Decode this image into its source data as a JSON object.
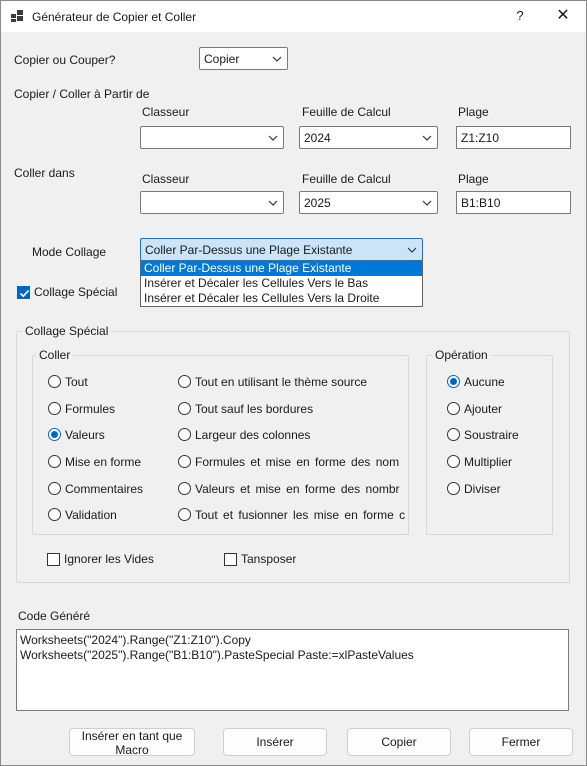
{
  "window": {
    "title": "Générateur de Copier et Coller",
    "help": "?",
    "close": "✕"
  },
  "copy_or_cut": {
    "label": "Copier ou Couper?",
    "value": "Copier"
  },
  "source": {
    "section_label": "Copier / Coller à Partir de",
    "workbook_label": "Classeur",
    "workbook_value": "",
    "sheet_label": "Feuille de Calcul",
    "sheet_value": "2024",
    "range_label": "Plage",
    "range_value": "Z1:Z10"
  },
  "dest": {
    "section_label": "Coller dans",
    "workbook_label": "Classeur",
    "workbook_value": "",
    "sheet_label": "Feuille de Calcul",
    "sheet_value": "2025",
    "range_label": "Plage",
    "range_value": "B1:B10"
  },
  "paste_mode": {
    "label": "Mode Collage",
    "value": "Coller Par-Dessus une Plage Existante",
    "options": [
      "Coller Par-Dessus une Plage Existante",
      "Insérer et Décaler les Cellules Vers le Bas",
      "Insérer et Décaler les Cellules Vers la Droite"
    ]
  },
  "special_checkbox": {
    "label": "Collage Spécial",
    "checked": true
  },
  "special_group": {
    "title": "Collage Spécial",
    "paste": {
      "title": "Coller",
      "left": [
        "Tout",
        "Formules",
        "Valeurs",
        "Mise en forme",
        "Commentaires",
        "Validation"
      ],
      "right": [
        "Tout en utilisant le thème source",
        "Tout sauf les bordures",
        "Largeur des colonnes",
        "Formules et mise en forme des nom",
        "Valeurs et mise en forme des nombr",
        "Tout et fusionner les mise en forme c"
      ],
      "selected": "Valeurs"
    },
    "operation": {
      "title": "Opération",
      "options": [
        "Aucune",
        "Ajouter",
        "Soustraire",
        "Multiplier",
        "Diviser"
      ],
      "selected": "Aucune"
    },
    "skip_blanks": {
      "label": "Ignorer les Vides",
      "checked": false
    },
    "transpose": {
      "label": "Tansposer",
      "checked": false
    }
  },
  "code": {
    "label": "Code Généré",
    "lines": [
      "Worksheets(\"2024\").Range(\"Z1:Z10\").Copy",
      "Worksheets(\"2025\").Range(\"B1:B10\").PasteSpecial Paste:=xlPasteValues"
    ]
  },
  "buttons": {
    "insert_macro": "Insérer en tant que Macro",
    "insert": "Insérer",
    "copy": "Copier",
    "close": "Fermer"
  }
}
